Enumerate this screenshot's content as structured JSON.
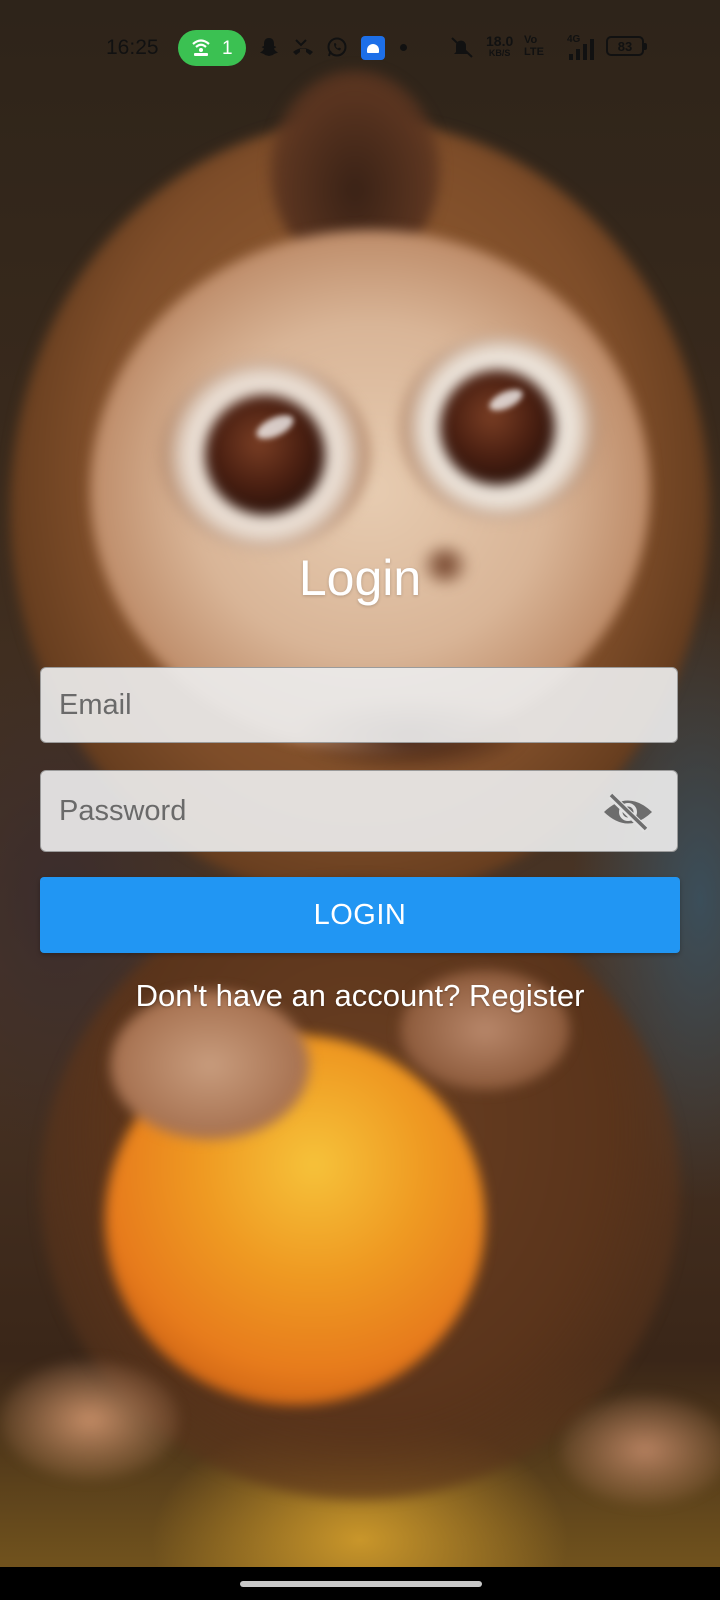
{
  "status_bar": {
    "time": "16:25",
    "hotspot_count": "1",
    "network_speed_value": "18.0",
    "network_speed_unit": "KB/S",
    "volte_top": "Vo",
    "volte_bottom": "LTE",
    "network_type": "4G",
    "battery_level": "83",
    "icons": [
      "hotspot-icon",
      "snapchat-icon",
      "missed-call-icon",
      "whatsapp-icon",
      "android-app-icon",
      "notification-dot",
      "mute-vibrate-icon",
      "volte-icon",
      "signal-icon",
      "battery-icon"
    ]
  },
  "login": {
    "title": "Login",
    "email_placeholder": "Email",
    "password_placeholder": "Password",
    "login_button": "LOGIN",
    "register_text": "Don't have an account? Register"
  },
  "colors": {
    "accent": "#2196f3",
    "hotspot_pill": "#3bc152",
    "title_text": "#ffffff"
  }
}
